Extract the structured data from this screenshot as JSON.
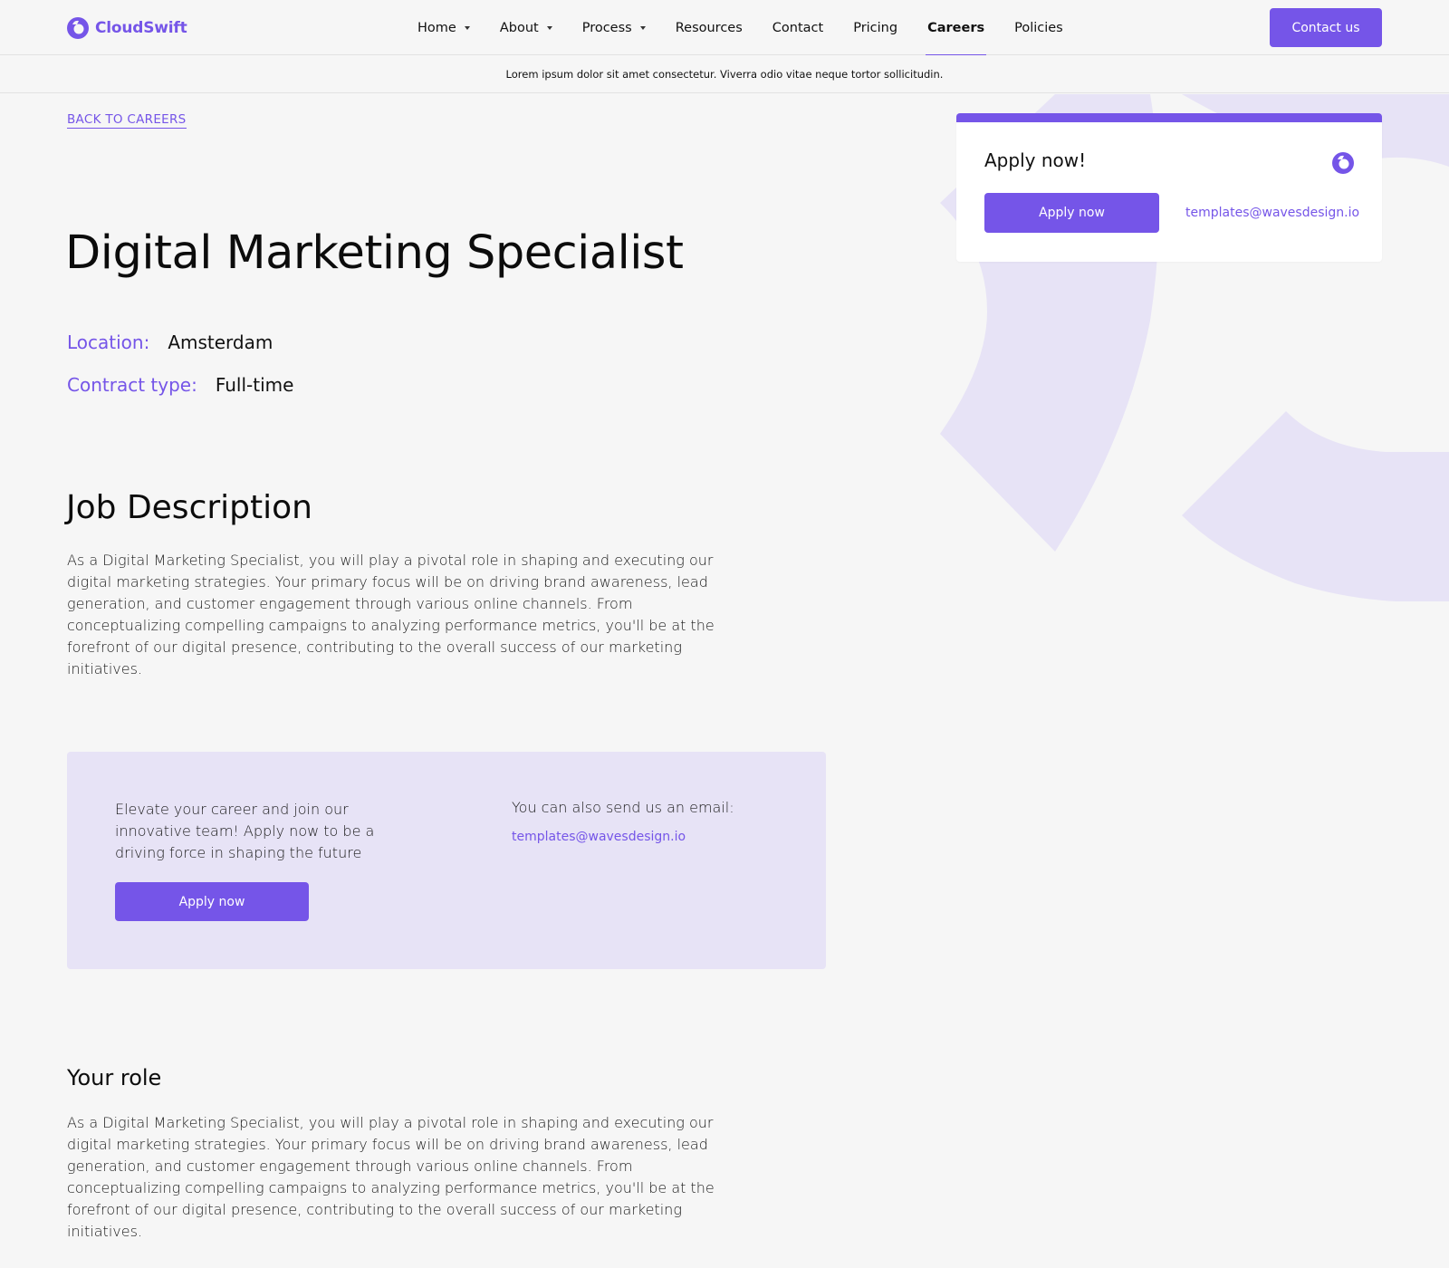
{
  "header": {
    "brand": "CloudSwift",
    "nav": [
      {
        "label": "Home",
        "dropdown": true
      },
      {
        "label": "About",
        "dropdown": true
      },
      {
        "label": "Process",
        "dropdown": true
      },
      {
        "label": "Resources",
        "dropdown": false
      },
      {
        "label": "Contact",
        "dropdown": false
      },
      {
        "label": "Pricing",
        "dropdown": false
      },
      {
        "label": "Careers",
        "dropdown": false,
        "active": true
      },
      {
        "label": "Policies",
        "dropdown": false
      }
    ],
    "contact_button": "Contact us",
    "announcement": "Lorem ipsum dolor sit amet consectetur. Viverra odio vitae neque tortor sollicitudin."
  },
  "job": {
    "back_link": "BACK TO CAREERS",
    "title": "Digital Marketing Specialist",
    "location_label": "Location:",
    "location_value": "Amsterdam",
    "contract_label": "Contract type:",
    "contract_value": "Full-time",
    "description_heading": "Job Description",
    "description": "As a Digital Marketing Specialist, you will play a pivotal role in shaping and executing our digital marketing strategies. Your primary focus will be on driving brand awareness, lead generation, and customer engagement through various online channels. From conceptualizing compelling campaigns to analyzing performance metrics, you'll be at the forefront of our digital presence, contributing to the overall success of our marketing initiatives.",
    "role_heading": "Your role",
    "role_text": "As a Digital Marketing Specialist, you will play a pivotal role in shaping and executing our digital marketing strategies. Your primary focus will be on driving brand awareness, lead generation, and customer engagement through various online channels. From conceptualizing compelling campaigns to analyzing performance metrics, you'll be at the forefront of our digital presence, contributing to the overall success of our marketing initiatives."
  },
  "apply_card": {
    "title": "Apply now!",
    "button": "Apply now",
    "email": "templates@wavesdesign.io",
    "icon": "brand-logo-icon"
  },
  "cta": {
    "text": "Elevate your career and join our innovative team! Apply now to be a driving force in shaping the future",
    "button": "Apply now",
    "email_label": "You can also send us an email:",
    "email": "templates@wavesdesign.io"
  },
  "colors": {
    "accent": "#7555e8",
    "accent_light": "#e7e3f6",
    "background": "#f6f6f6"
  }
}
